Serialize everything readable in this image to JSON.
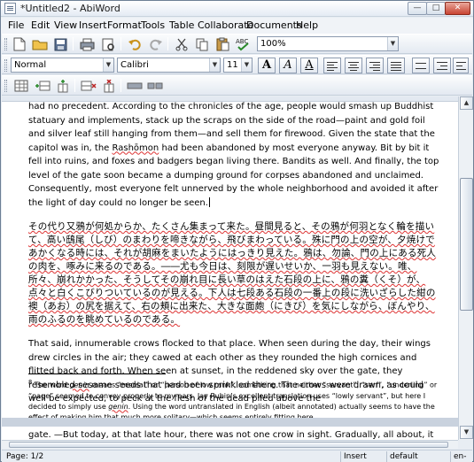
{
  "window": {
    "title": "*Untitled2 - AbiWord",
    "min_glyph": "—",
    "max_glyph": "□",
    "close_glyph": "✕"
  },
  "menu": [
    "File",
    "Edit",
    "View",
    "Insert",
    "Format",
    "Tools",
    "Table",
    "Collaborate",
    "Documents",
    "Help"
  ],
  "toolbar": {
    "zoom": "100%"
  },
  "format": {
    "style": "Normal",
    "font": "Calibri",
    "size": "11",
    "bold_label": "A",
    "italic_label": "A",
    "underline_label": "A"
  },
  "document": {
    "p1": "had no precedent. According to the chronicles of the age, people would smash up Buddhist statuary and implements, stack up the scraps on the side of the road—paint and gold foil and silver leaf still hanging from them—and sell them for firewood. Given the state that the capitol was in, the",
    "rashomon": "Rashōmon",
    "p1b": "had been abandoned by most everyone anyway. Bit by bit it fell into ruins, and foxes and badgers began living there. Bandits as well. And finally, the top level of the gate soon became a dumping ground for corpses abandoned and unclaimed. Consequently, most everyone felt unnerved by the whole neighborhood and avoided it after the light of day could no longer be seen.",
    "jp": "その代り又鴉が何処からか、たくさん集まって来た。昼間見ると、その鴉が何羽となく輪を描いて、高い鴟尾（しび）のまわりを啼きながら、飛びまわっている。殊に門の上の空が、夕焼けであかくなる時には、それが胡麻をまいたようにはっきり見えた。鴉は、勿論、門の上にある死人の肉を、啄みに来るのである。――尤も今日は、刻限が遅いせいか、一羽も見えない。唯、所々、崩れかかった、そうしてその崩れ目に長い草のはえた石段の上に、鴉の糞（くそ）が、点々と白くこびりついているのが見える。下人は七段ある石段の一番上の段に洗いざらした紺の襖（あお）の尻を据えて、右の頬に出来た、大きな面皰（にきび）を気にしながら、ぼんやり、雨のふるのを眺めているのである。",
    "p3": "That said, innumerable crows flocked to that place. When seen during the day, their wings drew circles in the air; they cawed at each other as they rounded the high cornices and flitted back and forth. When seen at sunset, in the reddened sky over the gate, they resembled sesame seeds that had been sprinkled there. The crows were drawn, as could well be expected, to peck at the flesh of the dead piled above the",
    "footnote_mark": "8",
    "footnote_a": "The word",
    "genin": "genin",
    "footnote_b": "means “menial” or “person of low rank”, something that neither “servant”, “serf”, “underling” or “page” seemed to convey properly to my ears. Jay Rubin’s excellent translation uses “lowly servant”, but here I decided to simply use",
    "footnote_c": ". Using the word untranslated in English (albeit annotated) actually seems to have the effect of making him that much more solitary—which seems entirely fitting here.",
    "page2": "gate. —But today, at that late hour, there was not one crow in sight. Gradually, all about, it had decayed,"
  },
  "status": {
    "page": "Page: 1/2",
    "mode": "Insert",
    "style": "default",
    "lang": "en-U"
  }
}
